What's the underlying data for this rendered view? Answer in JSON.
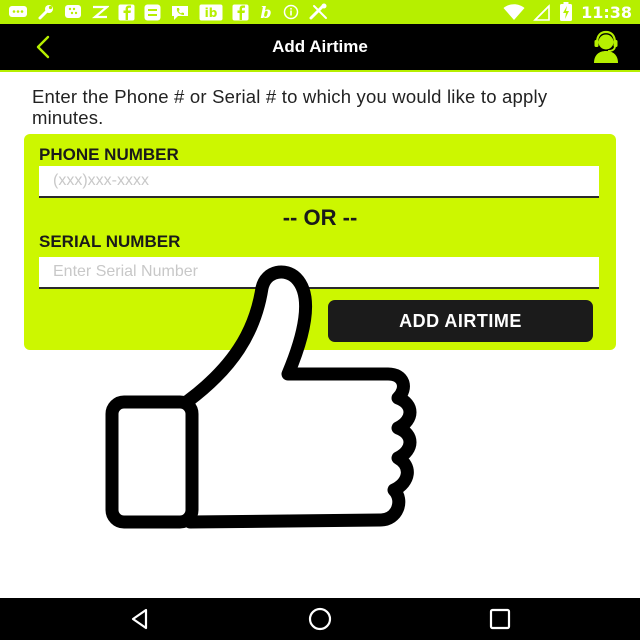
{
  "status_bar": {
    "time": "11:38",
    "icons": [
      "message-icon",
      "wrench-icon",
      "blackberry-icon",
      "zedge-icon",
      "facebook-icon",
      "equals-app-icon",
      "phone-chat-icon",
      "ib-icon",
      "facebook-icon",
      "b-app-icon",
      "info-icon",
      "tools-icon",
      "wifi-icon",
      "no-signal-icon",
      "battery-charging-icon"
    ]
  },
  "app_bar": {
    "title": "Add Airtime",
    "back_icon": "chevron-left-icon",
    "support_icon": "customer-support-icon"
  },
  "instructions": "Enter the Phone # or Serial # to which you would like to apply minutes.",
  "form": {
    "phone_label": "PHONE NUMBER",
    "phone_placeholder": "(xxx)xxx-xxxx",
    "phone_value": "",
    "or_text": "-- OR --",
    "serial_label": "SERIAL NUMBER",
    "serial_placeholder": "Enter Serial Number",
    "serial_value": "",
    "submit_label": "ADD AIRTIME"
  },
  "overlay": {
    "icon": "thumbs-up-icon"
  },
  "nav_bar": {
    "icons": [
      "back-triangle-icon",
      "home-circle-icon",
      "recents-square-icon"
    ]
  },
  "colors": {
    "accent": "#b6ef00",
    "card": "#ccf700",
    "app_bar": "#000000",
    "button": "#1b1b1b"
  }
}
